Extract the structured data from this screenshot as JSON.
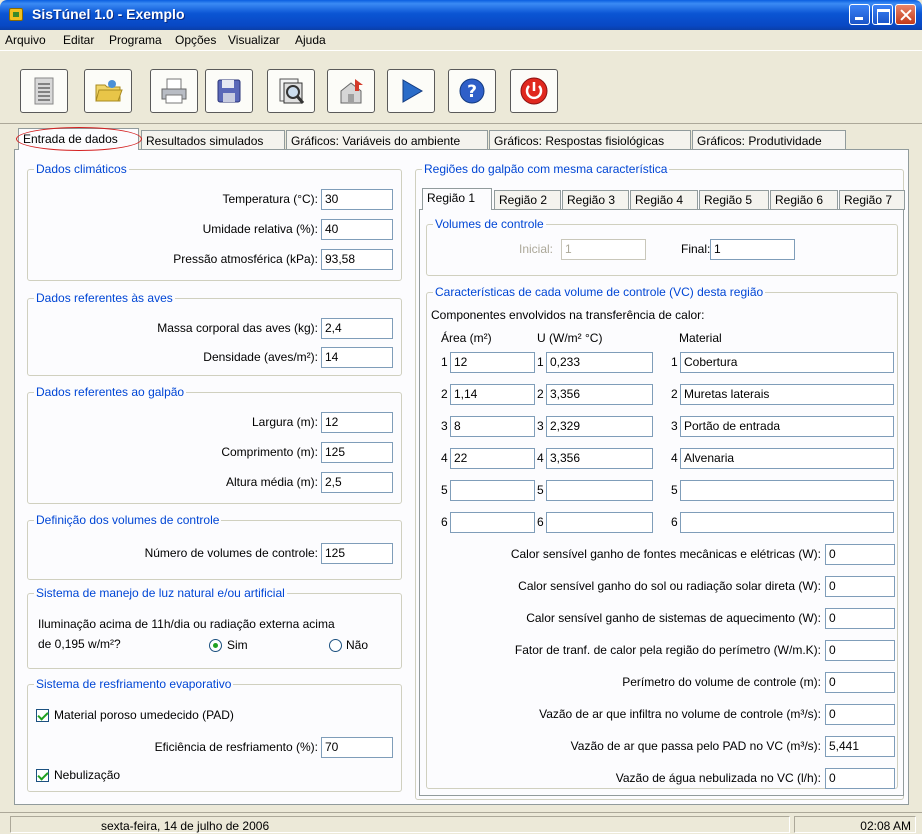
{
  "window": {
    "title": "SisTúnel 1.0 - Exemplo"
  },
  "menu": [
    {
      "label": "Arquivo"
    },
    {
      "label": "Editar"
    },
    {
      "label": "Programa"
    },
    {
      "label": "Opções"
    },
    {
      "label": "Visualizar"
    },
    {
      "label": "Ajuda"
    }
  ],
  "toolbar": [
    {
      "icon": "new-document-icon"
    },
    {
      "icon": "open-folder-icon"
    },
    {
      "icon": "print-icon"
    },
    {
      "icon": "save-icon"
    },
    {
      "icon": "print-preview-icon"
    },
    {
      "icon": "export-icon"
    },
    {
      "icon": "run-play-icon"
    },
    {
      "icon": "help-icon"
    },
    {
      "icon": "power-icon"
    }
  ],
  "tabs": [
    "Entrada de dados",
    "Resultados simulados",
    "Gráficos: Variáveis do ambiente",
    "Gráficos: Respostas fisiológicas",
    "Gráficos: Produtividade"
  ],
  "climate": {
    "title": "Dados climáticos",
    "temp_label": "Temperatura (°C):",
    "temp": "30",
    "hum_label": "Umidade relativa (%):",
    "hum": "40",
    "pres_label": "Pressão atmosférica (kPa):",
    "pres": "93,58"
  },
  "birds": {
    "title": "Dados referentes às aves",
    "mass_label": "Massa corporal das aves (kg):",
    "mass": "2,4",
    "dens_label": "Densidade (aves/m²):",
    "dens": "14"
  },
  "barn": {
    "title": "Dados referentes ao galpão",
    "width_label": "Largura (m):",
    "width": "12",
    "length_label": "Comprimento (m):",
    "length": "125",
    "height_label": "Altura média (m):",
    "height": "2,5"
  },
  "vc": {
    "title": "Definição dos volumes de controle",
    "num_label": "Número de volumes de controle:",
    "num": "125"
  },
  "light": {
    "title": "Sistema de manejo de luz natural e/ou artificial",
    "q1": "Iluminação acima de 11h/dia ou radiação externa acima",
    "q2": "de 0,195 w/m²?",
    "yes": "Sim",
    "no": "Não"
  },
  "cooling": {
    "title": "Sistema de resfriamento evaporativo",
    "pad": "Material poroso umedecido (PAD)",
    "eff_label": "Eficiência de resfriamento (%):",
    "eff": "70",
    "neb": "Nebulização"
  },
  "regions": {
    "title": "Regiões do galpão com mesma característica",
    "tabs": [
      "Região 1",
      "Região 2",
      "Região 3",
      "Região 4",
      "Região 5",
      "Região 6",
      "Região 7"
    ],
    "vol_title": "Volumes de controle",
    "initial_label": "Inicial:",
    "initial": "1",
    "final_label": "Final:",
    "final": "1",
    "char_title": "Características de cada volume de controle (VC) desta região",
    "comp_label": "Componentes envolvidos na transferência de calor:",
    "col_area": "Área (m²)",
    "col_u": "U (W/m² °C)",
    "col_mat": "Material",
    "rows": [
      {
        "n": "1",
        "area": "12",
        "u": "0,233",
        "mat": "Cobertura"
      },
      {
        "n": "2",
        "area": "1,14",
        "u": "3,356",
        "mat": "Muretas laterais"
      },
      {
        "n": "3",
        "area": "8",
        "u": "2,329",
        "mat": "Portão de entrada"
      },
      {
        "n": "4",
        "area": "22",
        "u": "3,356",
        "mat": "Alvenaria"
      },
      {
        "n": "5",
        "area": "",
        "u": "",
        "mat": ""
      },
      {
        "n": "6",
        "area": "",
        "u": "",
        "mat": ""
      }
    ],
    "params": [
      {
        "label": "Calor sensível ganho de fontes mecânicas e elétricas (W):",
        "value": "0"
      },
      {
        "label": "Calor sensível ganho do sol ou radiação solar direta (W):",
        "value": "0"
      },
      {
        "label": "Calor sensível ganho de sistemas de aquecimento (W):",
        "value": "0"
      },
      {
        "label": "Fator de tranf. de calor pela região do perímetro (W/m.K):",
        "value": "0"
      },
      {
        "label": "Perímetro do volume de controle (m):",
        "value": "0"
      },
      {
        "label": "Vazão de ar que infiltra no volume de controle (m³/s):",
        "value": "0"
      },
      {
        "label": "Vazão de ar que passa pelo PAD no VC (m³/s):",
        "value": "5,441"
      },
      {
        "label": "Vazão de água nebulizada no VC (l/h):",
        "value": "0"
      }
    ]
  },
  "status": {
    "date": "sexta-feira, 14 de julho de 2006",
    "time": "02:08 AM"
  }
}
